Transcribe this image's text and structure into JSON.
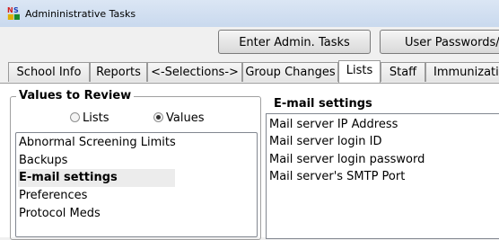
{
  "window": {
    "title": "Admininistrative Tasks"
  },
  "toolbar": {
    "enter_admin_tasks": "Enter Admin. Tasks",
    "user_passwords": "User Passwords/"
  },
  "tabs": [
    {
      "label": "School Info"
    },
    {
      "label": "Reports"
    },
    {
      "label": "<-Selections->"
    },
    {
      "label": "Group Changes"
    },
    {
      "label": "Lists",
      "active": true
    },
    {
      "label": "Staff"
    },
    {
      "label": "Immunizati"
    }
  ],
  "values_to_review": {
    "legend": "Values to Review",
    "radio_options": [
      {
        "label": "Lists",
        "checked": false
      },
      {
        "label": "Values",
        "checked": true
      }
    ],
    "items": [
      "Abnormal Screening Limits",
      "Backups",
      "E-mail settings",
      "Preferences",
      "Protocol Meds"
    ],
    "selected": "E-mail settings"
  },
  "detail": {
    "heading": "E-mail settings",
    "items": [
      "Mail server IP Address",
      "Mail server login ID",
      "Mail server login password",
      "Mail server's SMTP Port"
    ]
  }
}
